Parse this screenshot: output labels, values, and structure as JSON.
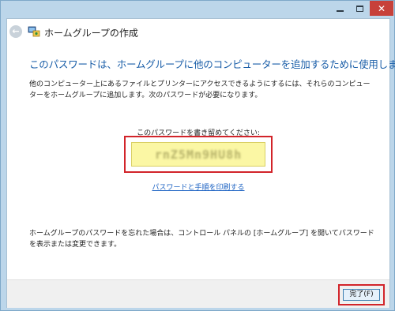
{
  "window": {
    "title": "ホームグループの作成",
    "close_glyph": "✕",
    "back_glyph": "←"
  },
  "content": {
    "heading": "このパスワードは、ホームグループに他のコンピューターを追加するために使用します",
    "description": "他のコンピューター上にあるファイルとプリンターにアクセスできるようにするには、それらのコンピューターをホームグループに追加します。次のパスワードが必要になります。",
    "password_label": "このパスワードを書き留めてください:",
    "password_value": "rnZ5Mn9HU8h",
    "print_link": "パスワードと手順を印刷する",
    "note": "ホームグループのパスワードを忘れた場合は、コントロール パネルの [ホームグループ] を開いてパスワードを表示または変更できます。"
  },
  "footer": {
    "finish_button": "完了(F)"
  },
  "colors": {
    "accent_heading": "#1a5ea8",
    "link": "#1d63c3",
    "highlight_frame": "#d2242a",
    "password_bg": "#fbf7a4",
    "titlebar": "#bcd6ea",
    "close_button": "#c7413a"
  },
  "icons": {
    "back": "back-arrow-icon",
    "homegroup": "homegroup-icon",
    "minimize": "minimize-icon",
    "maximize": "maximize-icon",
    "close": "close-icon"
  }
}
